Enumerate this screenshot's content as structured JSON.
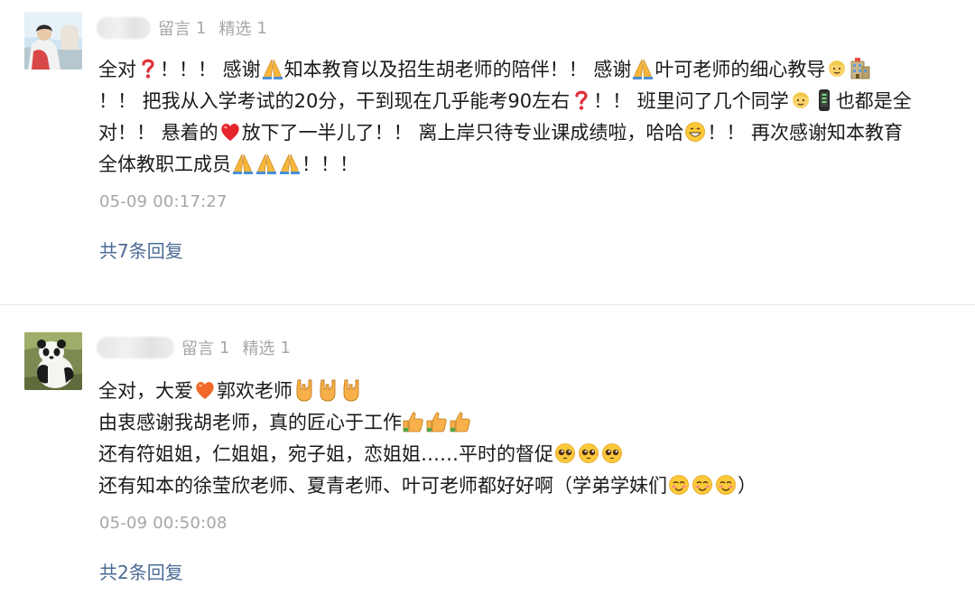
{
  "comments": [
    {
      "meta": {
        "message_label": "留言",
        "message_count": "1",
        "featured_label": "精选",
        "featured_count": "1"
      },
      "lines": {
        "l1a": "全对",
        "l1b": "！！！ 感谢",
        "l1c": "知本教育以及招生胡老师的陪伴！！ 感谢",
        "l1d": "叶可老师的细心教导",
        "l2a": "！！ 把我从入学考试的20分，干到现在几乎能考90左右",
        "l2b": "！！ 班里问了几个同学",
        "l2c": "也都是全",
        "l3a": "对！！ 悬着的",
        "l3b": "放下了一半儿了！！ 离上岸只待专业课成绩啦，哈哈",
        "l3c": "！！ 再次感谢知本教育",
        "l4a": "全体教职工成员",
        "l4b": "！！！"
      },
      "timestamp": "05-09 00:17:27",
      "reply_link": "共7条回复"
    },
    {
      "meta": {
        "message_label": "留言",
        "message_count": "1",
        "featured_label": "精选",
        "featured_count": "1"
      },
      "lines": {
        "l1a": "全对，大爱",
        "l1b": "郭欢老师",
        "l2a": "由衷感谢我胡老师，真的匠心于工作",
        "l3a": "还有符姐姐，仁姐姐，宛子姐，恋姐姐……平时的督促",
        "l4a": "还有知本的徐莹欣老师、夏青老师、叶可老师都好好啊（学弟学妹们",
        "l4b": "）"
      },
      "timestamp": "05-09 00:50:08",
      "reply_link": "共2条回复"
    }
  ],
  "icons": {
    "question": "red-question-mark-icon",
    "pray": "folded-hands-icon",
    "face": "smiling-face-icon",
    "building": "building-icon",
    "phone": "phone-icon",
    "heart": "red-heart-icon",
    "grin": "grinning-face-icon",
    "orange_heart": "orange-heart-icon",
    "rock": "rock-on-hand-icon",
    "thumb": "thumbs-up-icon",
    "pleading": "pleading-face-icon",
    "blush": "blushing-face-icon"
  },
  "colors": {
    "link": "#4a6a95",
    "meta": "#a6a6a6",
    "text": "#1a1a1a"
  }
}
